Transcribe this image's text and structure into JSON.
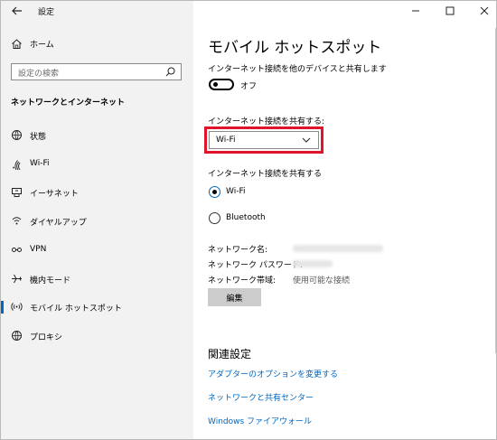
{
  "window": {
    "title": "設定"
  },
  "sidebar": {
    "home_label": "ホーム",
    "search_placeholder": "設定の検索",
    "section_heading": "ネットワークとインターネット",
    "items": [
      {
        "label": "状態",
        "icon": "globe-status-icon"
      },
      {
        "label": "Wi-Fi",
        "icon": "wifi-icon"
      },
      {
        "label": "イーサネット",
        "icon": "ethernet-icon"
      },
      {
        "label": "ダイヤルアップ",
        "icon": "dialup-icon"
      },
      {
        "label": "VPN",
        "icon": "vpn-icon"
      },
      {
        "label": "機内モード",
        "icon": "airplane-icon"
      },
      {
        "label": "モバイル ホットスポット",
        "icon": "hotspot-icon",
        "selected": true
      },
      {
        "label": "プロキシ",
        "icon": "proxy-globe-icon"
      }
    ]
  },
  "main": {
    "title": "モバイル ホットスポット",
    "share_description": "インターネット接続を他のデバイスと共有します",
    "toggle_state": "オフ",
    "toggle_on": false,
    "share_from_label": "インターネット接続を共有する:",
    "share_from_value": "Wi-Fi",
    "share_over_label": "インターネット接続を共有する",
    "share_over_options": [
      {
        "label": "Wi-Fi",
        "checked": true
      },
      {
        "label": "Bluetooth",
        "checked": false
      }
    ],
    "network_name_label": "ネットワーク名:",
    "network_password_label": "ネットワーク パスワード:",
    "network_band_label": "ネットワーク帯域:",
    "network_band_value": "使用可能な接続",
    "edit_button": "編集",
    "related_title": "関連設定",
    "links": [
      "アダプターのオプションを変更する",
      "ネットワークと共有センター",
      "Windows ファイアウォール"
    ]
  },
  "colors": {
    "accent": "#0067c0",
    "highlight": "#e0142b",
    "sidebar_bg": "#f2f2f2"
  }
}
